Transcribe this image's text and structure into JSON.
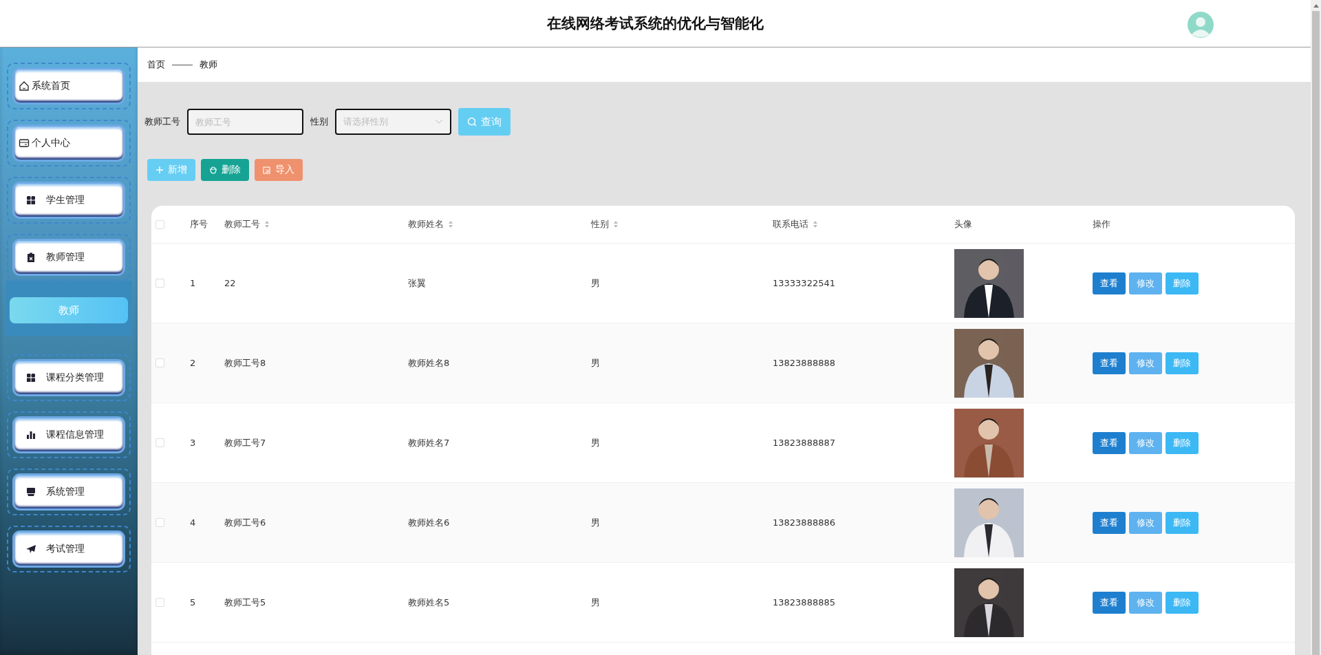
{
  "header": {
    "title": "在线网络考试系统的优化与智能化"
  },
  "sidebar": {
    "items": [
      {
        "label": "系统首页"
      },
      {
        "label": "个人中心"
      },
      {
        "label": "学生管理"
      },
      {
        "label": "教师管理",
        "children": [
          {
            "label": "教师",
            "selected": true
          }
        ]
      },
      {
        "label": "课程分类管理"
      },
      {
        "label": "课程信息管理"
      },
      {
        "label": "系统管理"
      },
      {
        "label": "考试管理"
      }
    ]
  },
  "breadcrumb": [
    "首页",
    "教师"
  ],
  "search": {
    "fields": [
      {
        "kind": "text",
        "label": "教师工号",
        "placeholder": "教师工号"
      },
      {
        "kind": "select",
        "label": "性别",
        "placeholder": "请选择性别"
      }
    ],
    "button": "查询"
  },
  "actions": [
    {
      "kind": "add",
      "label": "新增"
    },
    {
      "kind": "delete",
      "label": "删除"
    },
    {
      "kind": "import",
      "label": "导入"
    }
  ],
  "table": {
    "header_checked": false,
    "columns": [
      {
        "label": "序号",
        "sortable": false
      },
      {
        "label": "教师工号",
        "sortable": true
      },
      {
        "label": "教师姓名",
        "sortable": true
      },
      {
        "label": "性别",
        "sortable": true
      },
      {
        "label": "联系电话",
        "sortable": true
      },
      {
        "label": "头像",
        "sortable": false
      },
      {
        "label": "操作",
        "sortable": false
      }
    ],
    "rows": [
      {
        "checked": false,
        "cells": [
          "1",
          "22",
          "张翼",
          "男",
          "13333322541"
        ],
        "actions": [
          {
            "kind": "view",
            "label": "查看"
          },
          {
            "kind": "edit",
            "label": "修改"
          },
          {
            "kind": "delete",
            "label": "删除"
          }
        ]
      },
      {
        "checked": false,
        "cells": [
          "2",
          "教师工号8",
          "教师姓名8",
          "男",
          "13823888888"
        ],
        "actions": [
          {
            "kind": "view",
            "label": "查看"
          },
          {
            "kind": "edit",
            "label": "修改"
          },
          {
            "kind": "delete",
            "label": "删除"
          }
        ]
      },
      {
        "checked": false,
        "cells": [
          "3",
          "教师工号7",
          "教师姓名7",
          "男",
          "13823888887"
        ],
        "actions": [
          {
            "kind": "view",
            "label": "查看"
          },
          {
            "kind": "edit",
            "label": "修改"
          },
          {
            "kind": "delete",
            "label": "删除"
          }
        ]
      },
      {
        "checked": false,
        "cells": [
          "4",
          "教师工号6",
          "教师姓名6",
          "男",
          "13823888886"
        ],
        "actions": [
          {
            "kind": "view",
            "label": "查看"
          },
          {
            "kind": "edit",
            "label": "修改"
          },
          {
            "kind": "delete",
            "label": "删除"
          }
        ]
      },
      {
        "checked": false,
        "cells": [
          "5",
          "教师工号5",
          "教师姓名5",
          "男",
          "13823888885"
        ],
        "actions": [
          {
            "kind": "view",
            "label": "查看"
          },
          {
            "kind": "edit",
            "label": "修改"
          },
          {
            "kind": "delete",
            "label": "删除"
          }
        ]
      }
    ]
  }
}
